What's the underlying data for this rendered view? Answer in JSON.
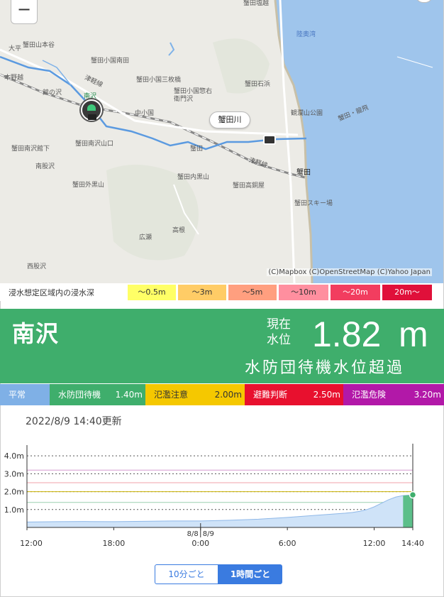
{
  "map": {
    "zoom_out_label": "−",
    "attribution": "(C)Mapbox (C)OpenStreetMap (C)Yahoo Japan",
    "river_tag": "蟹田川",
    "gauge_label": "南沢",
    "labels": {
      "kanimizu_shiomachi": "蟹田塩越",
      "mutsu_bay": "陸奥湾",
      "taihei": "大平",
      "kanita_yamamotoya": "蟹田山本谷",
      "kanita_oguni_minamida": "蟹田小国南田",
      "tsugaru_line1": "津軽線",
      "oguni_misakimachi": "蟹田小国三枚橋",
      "motonoiwa": "本野越",
      "yakatanosawa": "館の沢",
      "kanita_ishiyama": "蟹田石浜",
      "kanita_oguni_emon": "蟹田小国惣右衛門沢",
      "kanranzan": "観瀾山公園",
      "nakaoguni": "中小国",
      "kanita_ryuhi": "蟹田・龍飛",
      "kanita_minamisawa_tatesita": "蟹田南沢館下",
      "kanita_minamisawa_yamaguchi": "蟹田南沢山口",
      "kanita_kaku": "蟹田",
      "tsugaru_line2": "津軽線",
      "minamimatazawa": "南股沢",
      "kanita_station": "蟹田",
      "kanita_sotokuroyama": "蟹田外黒山",
      "kanita_uchikuroyama": "蟹田内黒山",
      "kanita_takaaoyama": "蟹田高銅屋",
      "kanita_ski": "蟹田スキー場",
      "hirose": "広瀬",
      "takaki": "高根",
      "nishimatazawa": "西股沢"
    }
  },
  "legend": {
    "title": "浸水想定区域内の浸水深",
    "items": [
      {
        "label": "〜0.5m",
        "color": "#ffff66"
      },
      {
        "label": "〜3m",
        "color": "#ffcc66"
      },
      {
        "label": "〜5m",
        "color": "#ff9f7f"
      },
      {
        "label": "〜10m",
        "color": "#ff8f9f"
      },
      {
        "label": "〜20m",
        "color": "#f23d5f"
      },
      {
        "label": "20m〜",
        "color": "#e0103a"
      }
    ]
  },
  "status": {
    "station_name": "南沢",
    "now_label": "現在 水位",
    "level": "1.82",
    "unit": "m",
    "text": "水防団待機水位超過",
    "color": "#3fae6c"
  },
  "thresholds": [
    {
      "name": "平常",
      "value": "",
      "color": "#7fb0e6",
      "text_color": "#ffffff"
    },
    {
      "name": "水防団待機",
      "value": "1.40m",
      "color": "#3fae6c",
      "text_color": "#ffffff"
    },
    {
      "name": "氾濫注意",
      "value": "2.00m",
      "color": "#f5c800",
      "text_color": "#333333"
    },
    {
      "name": "避難判断",
      "value": "2.50m",
      "color": "#e8102e",
      "text_color": "#ffffff"
    },
    {
      "name": "氾濫危険",
      "value": "3.20m",
      "color": "#b218a8",
      "text_color": "#ffffff"
    }
  ],
  "updated": "2022/8/9 14:40更新",
  "chart_data": {
    "type": "area",
    "y_ticks": [
      "4.0m",
      "3.0m",
      "2.0m",
      "1.0m"
    ],
    "y_tick_values": [
      4.0,
      3.0,
      2.0,
      1.0
    ],
    "ylim": [
      0,
      4.6
    ],
    "x_tick_labels": [
      "12:00",
      "18:00",
      "0:00",
      "6:00",
      "12:00",
      "14:40"
    ],
    "x_tick_hours": [
      0,
      6,
      12,
      18,
      24,
      26.67
    ],
    "date_labels": [
      "8/8",
      "8/9"
    ],
    "threshold_lines": [
      {
        "value": 3.2,
        "color": "#d59ad0"
      },
      {
        "value": 2.5,
        "color": "#f0a0a8"
      },
      {
        "value": 2.0,
        "color": "#c8b000"
      },
      {
        "value": 1.4,
        "color": "#9ad0b0"
      }
    ],
    "series": [
      {
        "hours": [
          0,
          2,
          4,
          6,
          8,
          10,
          12,
          14,
          16,
          18,
          20,
          21,
          22,
          22.5,
          23,
          23.5,
          24,
          24.5,
          25,
          25.5,
          26,
          26.67
        ],
        "values": [
          0.3,
          0.32,
          0.33,
          0.32,
          0.34,
          0.36,
          0.36,
          0.4,
          0.46,
          0.56,
          0.68,
          0.74,
          0.8,
          0.84,
          0.9,
          1.0,
          1.15,
          1.35,
          1.55,
          1.7,
          1.78,
          1.82
        ]
      }
    ],
    "current_point": {
      "hour": 26.67,
      "value": 1.82
    }
  },
  "toggle": {
    "ten_min": "10分ごと",
    "one_hour": "1時間ごと"
  }
}
